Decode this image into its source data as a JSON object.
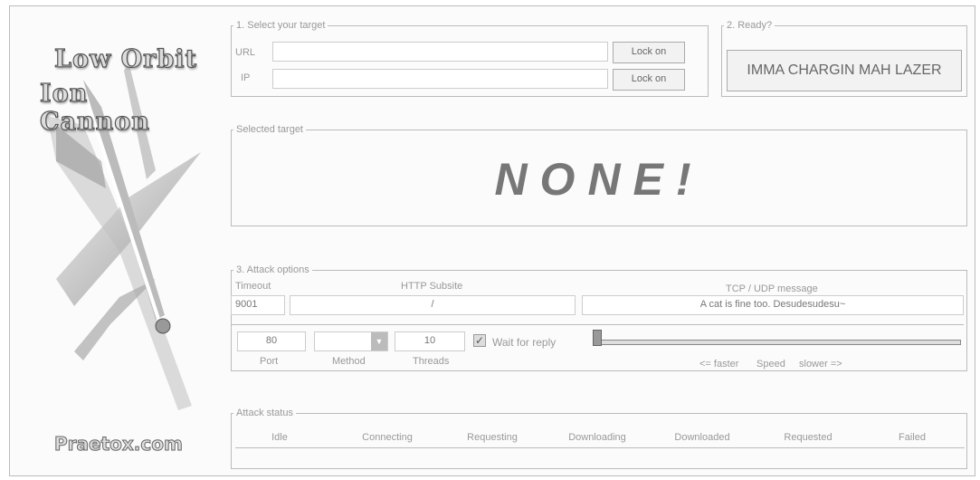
{
  "sidebar": {
    "logo_line1": "Low Orbit",
    "logo_line2": "Ion Cannon",
    "website": "Praetox.com"
  },
  "target": {
    "legend": "1. Select your target",
    "url_label": "URL",
    "ip_label": "IP",
    "url_value": "",
    "ip_value": "",
    "lock_on_url": "Lock on",
    "lock_on_ip": "Lock on"
  },
  "ready": {
    "legend": "2. Ready?",
    "fire_button": "IMMA CHARGIN MAH LAZER"
  },
  "selected": {
    "legend": "Selected target",
    "value": "NONE!"
  },
  "attack": {
    "legend": "3. Attack options",
    "timeout_label": "Timeout",
    "timeout_value": "9001",
    "subsite_label": "HTTP Subsite",
    "subsite_value": "/",
    "message_label": "TCP / UDP message",
    "message_value": "A cat is fine too. Desudesudesu~",
    "port_value": "80",
    "port_label": "Port",
    "method_value": "",
    "method_label": "Method",
    "threads_value": "10",
    "threads_label": "Threads",
    "wait_label": "Wait for reply",
    "wait_checked": true,
    "speed_faster": "<= faster",
    "speed_label": "Speed",
    "speed_slower": "slower =>",
    "speed_level": 0.0
  },
  "status": {
    "legend": "Attack status",
    "columns": [
      "Idle",
      "Connecting",
      "Requesting",
      "Downloading",
      "Downloaded",
      "Requested",
      "Failed"
    ]
  }
}
